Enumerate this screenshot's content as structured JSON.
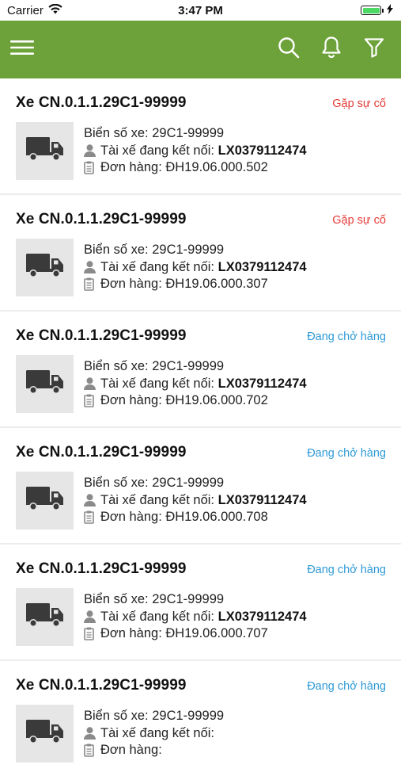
{
  "status_bar": {
    "carrier": "Carrier",
    "time": "3:47 PM"
  },
  "app_bar": {
    "accent": "#6da23a"
  },
  "labels": {
    "plate_prefix": "Biển số xe:",
    "driver_prefix": "Tài xế đang kết nối:",
    "order_prefix": "Đơn hàng:"
  },
  "vehicles": [
    {
      "title": "Xe CN.0.1.1.29C1-99999",
      "status": "Gặp sự cố",
      "status_type": "red",
      "plate": "29C1-99999",
      "driver": "LX0379112474",
      "order": "ĐH19.06.000.502"
    },
    {
      "title": "Xe CN.0.1.1.29C1-99999",
      "status": "Gặp sự cố",
      "status_type": "red",
      "plate": "29C1-99999",
      "driver": "LX0379112474",
      "order": "ĐH19.06.000.307"
    },
    {
      "title": "Xe CN.0.1.1.29C1-99999",
      "status": "Đang chở hàng",
      "status_type": "blue",
      "plate": "29C1-99999",
      "driver": "LX0379112474",
      "order": "ĐH19.06.000.702"
    },
    {
      "title": "Xe CN.0.1.1.29C1-99999",
      "status": "Đang chở hàng",
      "status_type": "blue",
      "plate": "29C1-99999",
      "driver": "LX0379112474",
      "order": "ĐH19.06.000.708"
    },
    {
      "title": "Xe CN.0.1.1.29C1-99999",
      "status": "Đang chở hàng",
      "status_type": "blue",
      "plate": "29C1-99999",
      "driver": "LX0379112474",
      "order": "ĐH19.06.000.707"
    },
    {
      "title": "Xe CN.0.1.1.29C1-99999",
      "status": "Đang chở hàng",
      "status_type": "blue",
      "plate": "29C1-99999",
      "driver": "",
      "order": ""
    }
  ]
}
